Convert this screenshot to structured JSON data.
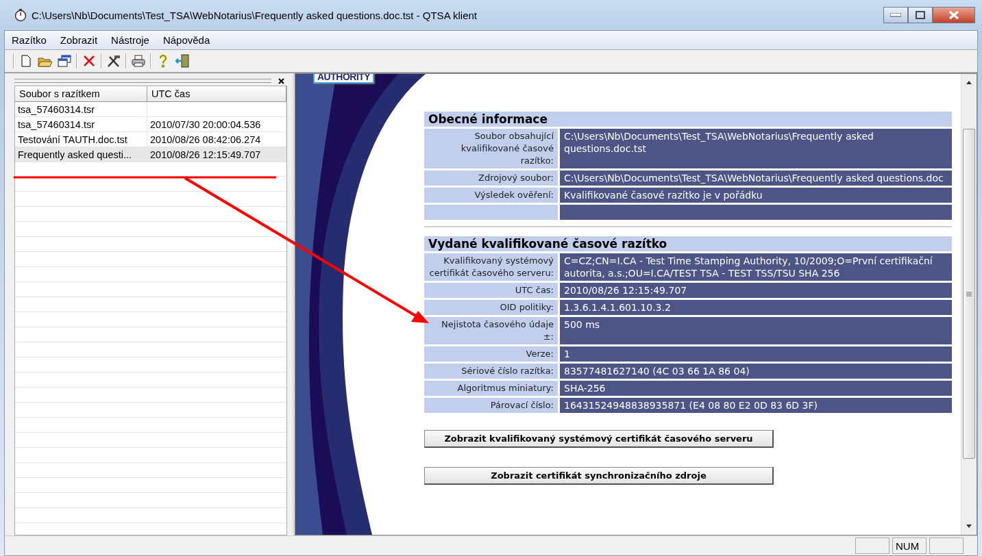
{
  "window": {
    "title": "C:\\Users\\Nb\\Documents\\Test_TSA\\WebNotarius\\Frequently asked questions.doc.tst - QTSA klient"
  },
  "menu": [
    {
      "label": "Razítko"
    },
    {
      "label": "Zobrazit"
    },
    {
      "label": "Nástroje"
    },
    {
      "label": "Nápověda"
    }
  ],
  "file_list": {
    "columns": [
      "Soubor s razítkem",
      "UTC čas"
    ],
    "rows": [
      {
        "file": "tsa_57460314.tsr",
        "selected": false
      },
      {
        "file": "tsa_57460314.tsr",
        "time": "2010/07/30  20:00:04.536",
        "selected": false
      },
      {
        "file": "Testování TAUTH.doc.tst",
        "time": "2010/08/26  08:42:06.274",
        "selected": false
      },
      {
        "file": "Frequently asked questi...",
        "time": "2010/08/26  12:15:49.707",
        "selected": true
      }
    ]
  },
  "logo": {
    "text": "AUTHORITY"
  },
  "sections": [
    {
      "title": "Obecné informace",
      "rows": [
        {
          "kind": "field",
          "label": "Soubor obsahující kvalifikované časové razítko:",
          "value": "C:\\Users\\Nb\\Documents\\Test_TSA\\WebNotarius\\Frequently asked questions.doc.tst"
        },
        {
          "kind": "field",
          "label": "Zdrojový soubor:",
          "value": "C:\\Users\\Nb\\Documents\\Test_TSA\\WebNotarius\\Frequently asked questions.doc"
        },
        {
          "kind": "field",
          "label": "Výsledek ověření:",
          "value": "Kvalifikované časové razítko je v pořádku"
        },
        {
          "kind": "blank"
        }
      ]
    },
    {
      "title": "Vydané kvalifikované časové razítko",
      "rows": [
        {
          "kind": "field",
          "label": "Kvalifikovaný systémový certifikát časového serveru:",
          "value": "C=CZ;CN=I.CA - Test Time Stamping Authority, 10/2009;O=První certifikační autorita, a.s.;OU=I.CA/TEST TSA - TEST TSS/TSU SHA 256"
        },
        {
          "kind": "field",
          "label": "UTC čas:",
          "value": "2010/08/26  12:15:49.707"
        },
        {
          "kind": "field",
          "label": "OID politiky:",
          "value": "1.3.6.1.4.1.601.10.3.2"
        },
        {
          "kind": "field",
          "label": "Nejistota časového údaje ±:",
          "value": "500 ms"
        },
        {
          "kind": "field",
          "label": "Verze:",
          "value": "1"
        },
        {
          "kind": "field",
          "label": "Sériové číslo razítka:",
          "value": "83577481627140 (4C 03 66 1A 86 04)"
        },
        {
          "kind": "field",
          "label": "Algoritmus miniatury:",
          "value": "SHA-256"
        },
        {
          "kind": "field",
          "label": "Párovací číslo:",
          "value": "16431524948838935871 (E4 08 80 E2 0D 83 6D 3F)"
        }
      ]
    }
  ],
  "buttons": [
    "Zobrazit kvalifikovaný systémový certifikát časového serveru",
    "Zobrazit certifikát synchronizačního zdroje"
  ],
  "status_bar": {
    "indicators": [
      "NUM"
    ]
  }
}
